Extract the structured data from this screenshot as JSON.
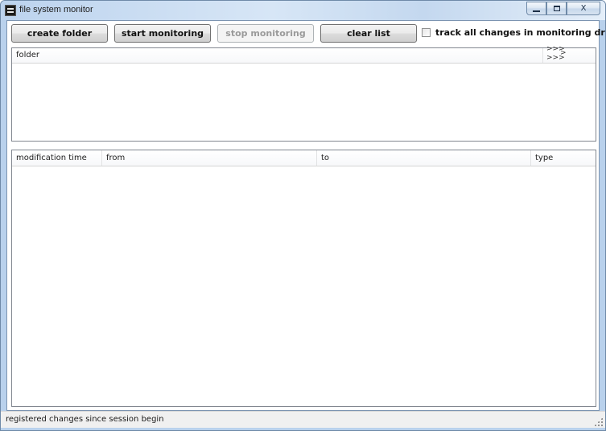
{
  "window": {
    "title": "file system monitor",
    "app_icon": "terminal-icon",
    "controls": {
      "minimize_icon": "minimize-icon",
      "maximize_icon": "maximize-icon",
      "close_label": "X",
      "close_icon": "close-icon"
    }
  },
  "toolbar": {
    "create_folder_label": "create folder",
    "start_monitoring_label": "start monitoring",
    "stop_monitoring_label": "stop monitoring",
    "clear_list_label": "clear list",
    "track_all_label": "track all changes in monitoring drives",
    "track_all_checked": false
  },
  "folder_list": {
    "columns": [
      "folder"
    ],
    "overflow_top": ">>>",
    "overflow_single": ">",
    "overflow_bottom": ">>>",
    "rows": []
  },
  "events_list": {
    "columns": [
      "modification time",
      "from",
      "to",
      "type"
    ],
    "rows": []
  },
  "statusbar": {
    "text": "registered changes since session begin"
  },
  "colors": {
    "titlebar": "#c4d8ef",
    "border": "#7c94b1",
    "disabled_text": "#9a9a9a"
  }
}
